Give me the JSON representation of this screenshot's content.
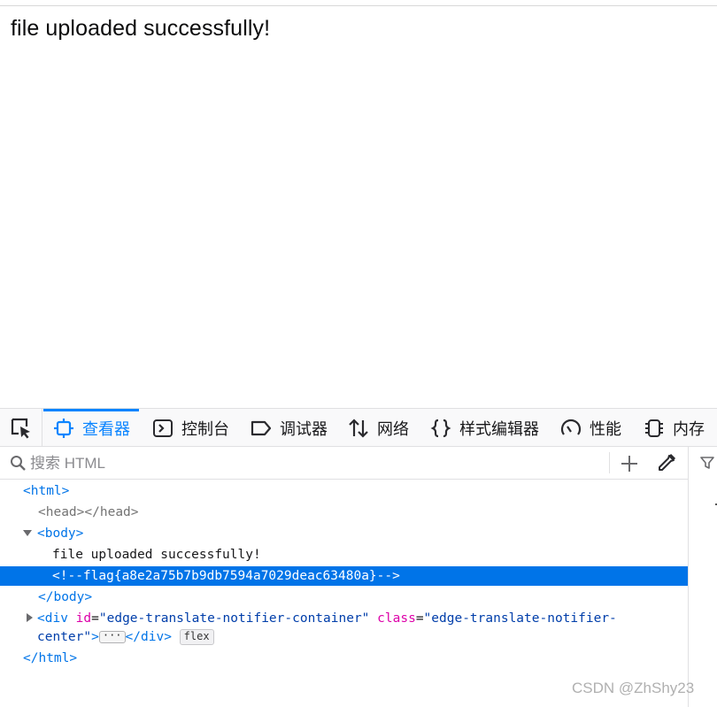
{
  "page": {
    "message": "file uploaded successfully!"
  },
  "devtools": {
    "tabs": [
      {
        "id": "inspector",
        "label": "查看器",
        "icon": "inspector-icon",
        "selected": true
      },
      {
        "id": "console",
        "label": "控制台",
        "icon": "console-icon"
      },
      {
        "id": "debugger",
        "label": "调试器",
        "icon": "debugger-icon"
      },
      {
        "id": "network",
        "label": "网络",
        "icon": "network-icon"
      },
      {
        "id": "style-editor",
        "label": "样式编辑器",
        "icon": "braces-icon"
      },
      {
        "id": "performance",
        "label": "性能",
        "icon": "gauge-icon"
      },
      {
        "id": "memory",
        "label": "内存",
        "icon": "memory-chip-icon"
      }
    ],
    "search": {
      "placeholder": "搜索 HTML",
      "value": ""
    },
    "markup": {
      "html_open": "html",
      "head": "head",
      "body_open": "body",
      "text_node": "file uploaded successfully!",
      "comment": "<!--flag{a8e2a75b7b9db7594a7029deac63480a}-->",
      "div_tag": "div",
      "div_attr_id_name": "id",
      "div_attr_id_value": "\"edge-translate-notifier-container\"",
      "div_attr_class_name": "class",
      "div_attr_class_value_1": "\"edge-translate-notifier-",
      "div_attr_class_value_2": "center\"",
      "ellipsis": "···",
      "flex_badge": "flex",
      "body_close": "body",
      "html_close": "html"
    },
    "accent_color": "#0a84ff",
    "selection_color": "#0074e8"
  },
  "watermark": "CSDN @ZhShy23"
}
